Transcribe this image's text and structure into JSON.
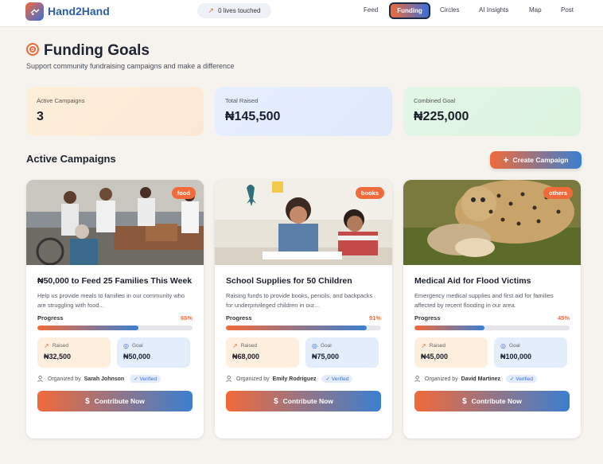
{
  "app": {
    "brand": "Hand2Hand",
    "lives_touched": "0 lives touched"
  },
  "nav": {
    "feed": "Feed",
    "funding": "Funding",
    "circles": "Circles",
    "ai_insights": "AI Insights",
    "map": "Map",
    "post": "Post"
  },
  "header": {
    "title": "Funding Goals",
    "subtitle": "Support community fundraising campaigns and make a difference"
  },
  "stats": {
    "active_label": "Active Campaigns",
    "active_value": "3",
    "raised_label": "Total Raised",
    "raised_value": "₦145,500",
    "goal_label": "Combined Goal",
    "goal_value": "₦225,000"
  },
  "section": {
    "title": "Active Campaigns",
    "create_label": "Create Campaign"
  },
  "campaigns": [
    {
      "tag": "food",
      "title": "₦50,000 to Feed 25 Families This Week",
      "description": "Help us provide meals to families in our community who are struggling with food...",
      "progress_label": "Progress",
      "progress_pct": "65%",
      "progress": 0.65,
      "raised_label": "Raised",
      "raised": "₦32,500",
      "goal_label": "Goal",
      "goal": "₦50,000",
      "organized_prefix": "Organized by",
      "organizer": "Sarah Johnson",
      "verified": "✓ Verified",
      "cta": "Contribute Now"
    },
    {
      "tag": "books",
      "title": "School Supplies for 50 Children",
      "description": "Raising funds to provide books, pencils, and backpacks for underprivileged children in our...",
      "progress_label": "Progress",
      "progress_pct": "91%",
      "progress": 0.91,
      "raised_label": "Raised",
      "raised": "₦68,000",
      "goal_label": "Goal",
      "goal": "₦75,000",
      "organized_prefix": "Organized by",
      "organizer": "Emily Rodriguez",
      "verified": "✓ Verified",
      "cta": "Contribute Now"
    },
    {
      "tag": "others",
      "title": "Medical Aid for Flood Victims",
      "description": "Emergency medical supplies and first aid for families affected by recent flooding in our area.",
      "progress_label": "Progress",
      "progress_pct": "45%",
      "progress": 0.45,
      "raised_label": "Raised",
      "raised": "₦45,000",
      "goal_label": "Goal",
      "goal": "₦100,000",
      "organized_prefix": "Organized by",
      "organizer": "David Martinez",
      "verified": "✓ Verified",
      "cta": "Contribute Now"
    }
  ],
  "colors": {
    "accent_orange": "#f06a3a",
    "accent_blue": "#3b6fd9",
    "brand_text": "#2e5fa6"
  }
}
